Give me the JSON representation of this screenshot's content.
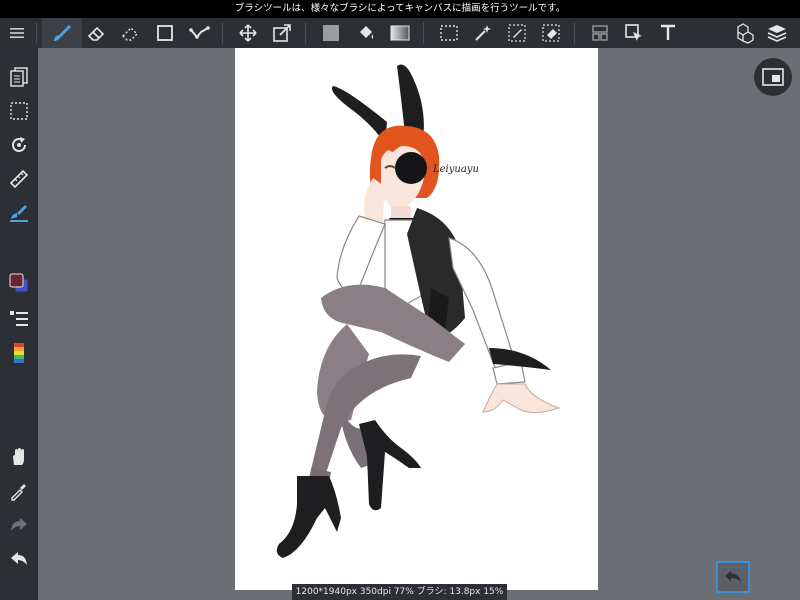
{
  "status_top": {
    "message": "ブラシツールは、様々なブラシによってキャンバスに描画を行うツールです。"
  },
  "toolbar": {
    "items": [
      {
        "name": "menu-icon",
        "active": false
      },
      {
        "name": "brush-tool-icon",
        "active": true
      },
      {
        "name": "eraser-tool-icon",
        "active": false
      },
      {
        "name": "blur-eraser-tool-icon",
        "active": false
      },
      {
        "name": "shape-tool-icon",
        "active": false
      },
      {
        "name": "polyline-tool-icon",
        "active": false
      },
      {
        "name": "move-tool-icon",
        "active": false
      },
      {
        "name": "transform-tool-icon",
        "active": false
      },
      {
        "name": "fill-color-icon",
        "active": false
      },
      {
        "name": "bucket-tool-icon",
        "active": false
      },
      {
        "name": "gradient-tool-icon",
        "active": false
      },
      {
        "name": "select-rect-icon",
        "active": false
      },
      {
        "name": "magic-wand-icon",
        "active": false
      },
      {
        "name": "select-pen-icon",
        "active": false
      },
      {
        "name": "select-eraser-icon",
        "active": false
      },
      {
        "name": "select-layer-icon",
        "active": false
      },
      {
        "name": "operation-tool-icon",
        "active": false
      },
      {
        "name": "text-tool-icon",
        "active": false
      },
      {
        "name": "material-icon",
        "active": false
      },
      {
        "name": "layers-icon",
        "active": false
      }
    ]
  },
  "leftbar": {
    "items": [
      {
        "name": "page-manager-icon"
      },
      {
        "name": "selection-icon"
      },
      {
        "name": "rotate-canvas-icon"
      },
      {
        "name": "ruler-icon"
      },
      {
        "name": "brush-settings-icon",
        "active": true
      },
      {
        "name": "color-swatch-icon",
        "fg": "#6b2233",
        "bg": "#4050c8"
      },
      {
        "name": "layer-list-icon"
      },
      {
        "name": "color-palette-icon"
      },
      {
        "name": "hand-tool-icon"
      },
      {
        "name": "eyedropper-icon"
      },
      {
        "name": "redo-icon",
        "disabled": true
      },
      {
        "name": "undo-icon"
      }
    ]
  },
  "canvas": {
    "signature_text": "Leiyuayu"
  },
  "status_bottom": {
    "info": "1200*1940px 350dpi 77% ブラシ: 13.8px 15%"
  },
  "colors": {
    "accent": "#4ba3e3",
    "panel": "#2c2f33",
    "workspace": "#6b6e73",
    "hair": "#e2541e",
    "outfit": "#2a2a2a",
    "stockings": "#8a7f85"
  }
}
